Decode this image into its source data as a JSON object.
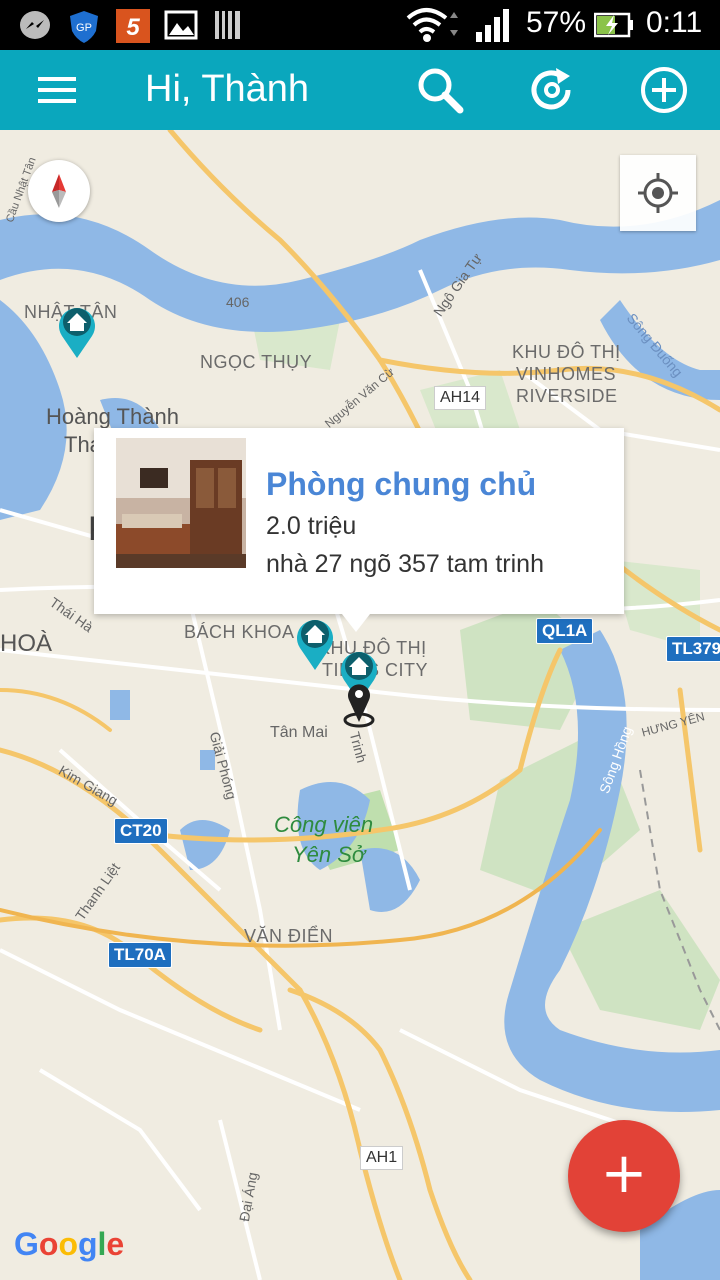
{
  "status_bar": {
    "battery_percent": "57%",
    "time": "0:11",
    "icons": [
      "messenger-icon",
      "shield-gp-icon",
      "number-5-icon",
      "image-icon",
      "barcode-icon",
      "wifi-icon",
      "signal-icon",
      "battery-charging-icon"
    ]
  },
  "app_bar": {
    "title": "Hi, Thành",
    "color": "#0aa7bd",
    "icons": [
      "menu-icon",
      "search-icon",
      "refresh-icon",
      "add-circle-icon"
    ]
  },
  "map": {
    "labels": {
      "nhat_tan": "NHẬT TÂN",
      "cau_nhat_tan": "Cầu Nhật Tân",
      "ngoc_thuy": "NGỌC THỤY",
      "hoang_thanh": "Hoàng Thành",
      "thang": "Tha",
      "k_letter": "K",
      "khu_do_thi": "KHU ĐÔ THỊ",
      "vinhomes": "VINHOMES",
      "riverside": "RIVERSIDE",
      "ngo_gia_tu": "Ngô Gia Tự",
      "nguyen_van_cu": "Nguyễn Văn Cừ",
      "song_duong": "Sông Đuống",
      "thai_ha": "Thái Hà",
      "hoa": "HOÀ",
      "bach_khoa": "BÁCH KHOA",
      "times_city_1": "KHU ĐÔ THỊ",
      "times_city_2": "TIMES CITY",
      "tan_mai": "Tân Mai",
      "giai_phong": "Giải Phóng",
      "kim_giang": "Kim Giang",
      "tam_trinh": "Trinh",
      "cong_vien": "Công viên",
      "yen_so": "Yên Sở",
      "thanh_liet": "Thanh Liệt",
      "van_dien": "VĂN ĐIỂN",
      "hung_yen": "HƯNG YÊN",
      "song_hong": "Sông Hồng",
      "dai_ang": "Đại Áng",
      "r406": "406"
    },
    "shields": {
      "ah14": "AH14",
      "ql1a": "QL1A",
      "tl379": "TL379",
      "ct20": "CT20",
      "tl70a": "TL70A",
      "ah1": "AH1"
    },
    "attribution": "Google"
  },
  "popup": {
    "title": "Phòng chung chủ",
    "price": "2.0 triệu",
    "address": "nhà 27 ngõ 357 tam trinh"
  },
  "fab": {
    "label": "+",
    "color": "#e24237"
  }
}
